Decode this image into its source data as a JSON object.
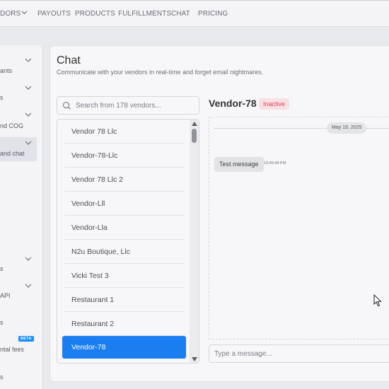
{
  "nav": {
    "items": [
      {
        "label": "DORS",
        "x": 0
      },
      {
        "label": "PAYOUTS"
      },
      {
        "label": "PRODUCTS"
      },
      {
        "label": "FULFILLMENTS"
      },
      {
        "label": "CHAT"
      },
      {
        "label": "PRICING"
      }
    ]
  },
  "sidebar": {
    "items": [
      {
        "label": "ants"
      },
      {
        "label": "s"
      },
      {
        "label": "nd COG"
      },
      {
        "label": "and chat"
      },
      {
        "label": "s"
      },
      {
        "label": "API"
      },
      {
        "label": "s"
      },
      {
        "label": "ntal fees"
      },
      {
        "label": "s"
      }
    ],
    "beta_label": "BETA"
  },
  "chat": {
    "title": "Chat",
    "subtitle": "Communicate with your vendors in real-time and forget email nightmares.",
    "search_placeholder": "Search from 178 vendors...",
    "vendors": [
      "Vendor 78 Llc",
      "Vendor-78-Llc",
      "Vendor 78 Llc 2",
      "Vendor-Lll",
      "Vendor-Lla",
      "N2u Boutique, Llc",
      "Vicki Test 3",
      "Restaurant 1",
      "Restaurant 2",
      "Vendor-78"
    ],
    "selected_vendor": "Vendor-78",
    "active_name": "Vendor-78",
    "status": "Inactive",
    "date": "May 19, 2025",
    "messages": [
      {
        "text": "Test message",
        "time": "10:45:44 PM"
      }
    ],
    "composer_placeholder": "Type a message..."
  },
  "colors": {
    "accent": "#1a7ef0",
    "status_bg": "#fbe0e3",
    "status_text": "#d9455a"
  }
}
